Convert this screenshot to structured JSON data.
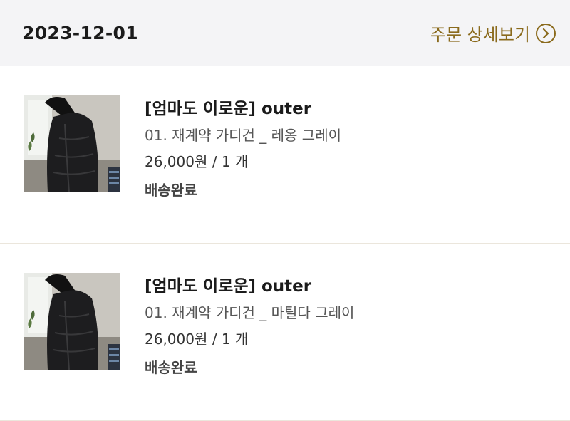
{
  "header": {
    "date": "2023-12-01",
    "detail_label": "주문 상세보기",
    "detail_icon": "chevron-right-circle-icon",
    "accent_color": "#8a6a1c"
  },
  "items": [
    {
      "name": "[엄마도 이로운] outer",
      "option": "01. 재계약 가디건 _ 레옹 그레이",
      "price": "26,000원",
      "sep": "/",
      "qty": "1 개",
      "status": "배송완료"
    },
    {
      "name": "[엄마도 이로운] outer",
      "option": "01. 재계약 가디건 _ 마틸다 그레이",
      "price": "26,000원",
      "sep": "/",
      "qty": "1 개",
      "status": "배송완료"
    }
  ]
}
